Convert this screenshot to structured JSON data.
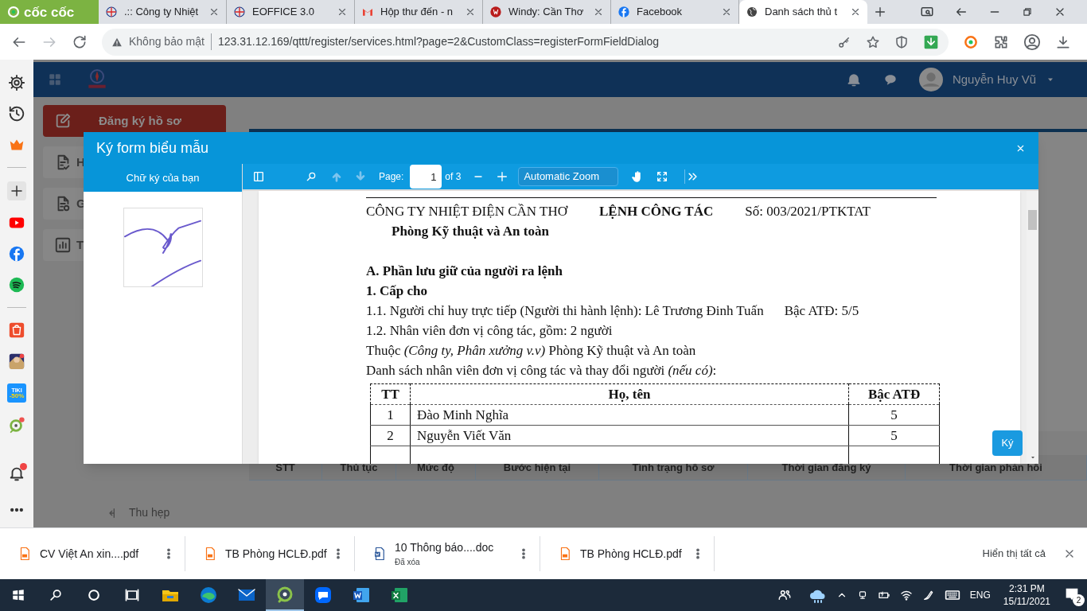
{
  "browser": {
    "brand": "cốc cốc",
    "tabs": [
      {
        "title": ".:: Công ty Nhiệt",
        "selected": false
      },
      {
        "title": "EOFFICE 3.0",
        "selected": false
      },
      {
        "title": "Hộp thư đến - n",
        "selected": false
      },
      {
        "title": "Windy: Cần Thơ",
        "selected": false
      },
      {
        "title": "Facebook",
        "selected": false
      },
      {
        "title": "Danh sách thủ t",
        "selected": true
      }
    ],
    "address": {
      "security": "Không bảo mật",
      "url": "123.31.12.169/qttt/register/services.html?page=2&CustomClass=registerFormFieldDialog"
    }
  },
  "browser_sidebar": [
    {
      "kind": "gear"
    },
    {
      "kind": "history"
    },
    {
      "kind": "crown"
    },
    {
      "kind": "divider"
    },
    {
      "kind": "plus"
    },
    {
      "kind": "youtube"
    },
    {
      "kind": "facebook"
    },
    {
      "kind": "spotify"
    },
    {
      "kind": "divider"
    },
    {
      "kind": "shopee"
    },
    {
      "kind": "game"
    },
    {
      "kind": "tiki",
      "label": "TIKI",
      "sub": "-50%"
    },
    {
      "kind": "coccoc"
    }
  ],
  "app": {
    "user": "Nguyễn Huy Vũ",
    "nav": [
      {
        "label": "Đăng ký hồ sơ",
        "selected": true
      },
      {
        "label": "H",
        "selected": false
      },
      {
        "label": "G",
        "selected": false
      },
      {
        "label": "T",
        "selected": false
      }
    ],
    "collapse": "Thu hẹp",
    "table": {
      "columns": [
        "STT",
        "Thủ tục",
        "Mức độ",
        "Bước hiện tại",
        "Tình trạng hồ sơ",
        "Thời gian đăng ký",
        "Thời gian phản hồi"
      ]
    }
  },
  "dialog": {
    "title": "Ký form biểu mẫu",
    "signature_panel": {
      "title": "Chữ ký của bạn"
    },
    "viewer": {
      "page_label": "Page:",
      "page": "1",
      "page_count": "of 3",
      "zoom": "Automatic Zoom"
    },
    "document": {
      "company": "CÔNG TY NHIỆT ĐIỆN CẦN THƠ",
      "doc_type": "LỆNH CÔNG TÁC",
      "number": "Số: 003/2021/PTKTAT",
      "department": "Phòng Kỹ thuật và An toàn",
      "lines": [
        {
          "kind": "gap"
        },
        {
          "kind": "heading",
          "text": "A. Phần lưu giữ của người ra lệnh"
        },
        {
          "kind": "heading",
          "text": "1. Cấp cho"
        },
        {
          "kind": "text",
          "text": "1.1. Người chỉ huy trực tiếp (Người thi hành lệnh): Lê Trương Đinh Tuấn",
          "right": "Bậc ATĐ: 5/5"
        },
        {
          "kind": "text",
          "text": "1.2. Nhân viên đơn vị công tác, gồm: 2  người"
        },
        {
          "kind": "text",
          "text": "Thuộc *(Công ty, Phân xưởng v.v)* Phòng Kỹ thuật và An toàn"
        },
        {
          "kind": "text",
          "text": "Danh sách nhân viên đơn vị công tác và thay đổi người *(nếu có)*:"
        }
      ],
      "table": {
        "columns": [
          "TT",
          "Họ, tên",
          "Bậc ATĐ"
        ],
        "rows": [
          [
            "1",
            "Đào Minh Nghĩa",
            "5"
          ],
          [
            "2",
            "Nguyễn Viết Văn",
            "5"
          ]
        ]
      }
    },
    "sign_button": "Ký"
  },
  "downloads": {
    "items": [
      {
        "name": "CV Việt An xin....pdf",
        "kind": "pdf"
      },
      {
        "name": "TB Phòng HCLĐ.pdf",
        "kind": "pdf"
      },
      {
        "name": "10 Thông báo....doc",
        "kind": "doc",
        "note": "Đã xóa"
      },
      {
        "name": "TB Phòng HCLĐ.pdf",
        "kind": "pdf"
      }
    ],
    "show_all": "Hiển thị tất cả"
  },
  "taskbar": {
    "apps": [
      {
        "kind": "explorer",
        "active": false
      },
      {
        "kind": "edge",
        "active": false
      },
      {
        "kind": "mail",
        "active": false
      },
      {
        "kind": "coccoc",
        "active": true
      },
      {
        "kind": "zalo",
        "active": false
      },
      {
        "kind": "word",
        "active": false
      },
      {
        "kind": "excel",
        "active": false
      }
    ],
    "language": "ENG",
    "time": "2:31 PM",
    "date": "15/11/2021",
    "notifications": "2"
  }
}
